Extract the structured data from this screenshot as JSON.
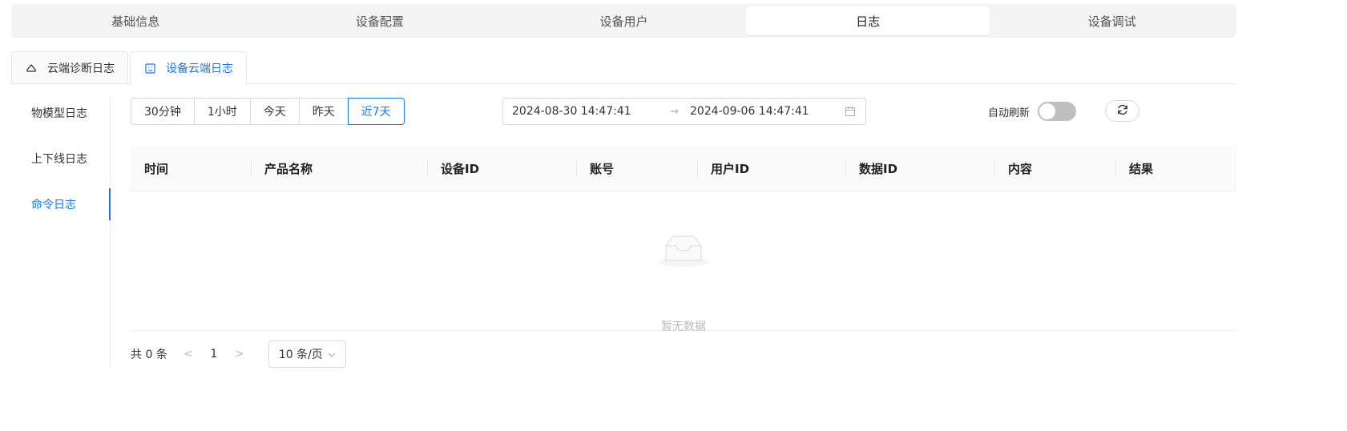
{
  "top_tabs": [
    {
      "label": "基础信息"
    },
    {
      "label": "设备配置"
    },
    {
      "label": "设备用户"
    },
    {
      "label": "日志",
      "active": true
    },
    {
      "label": "设备调试"
    }
  ],
  "card_tabs": [
    {
      "label": "云端诊断日志",
      "icon": "cloud-icon"
    },
    {
      "label": "设备云端日志",
      "icon": "device-icon",
      "active": true
    }
  ],
  "side_menu": [
    {
      "label": "物模型日志"
    },
    {
      "label": "上下线日志"
    },
    {
      "label": "命令日志",
      "active": true
    }
  ],
  "toolbar": {
    "ranges": [
      "30分钟",
      "1小时",
      "今天",
      "昨天",
      "近7天"
    ],
    "active_range": "近7天",
    "date_start": "2024-08-30 14:47:41",
    "date_sep": "→",
    "date_end": "2024-09-06 14:47:41",
    "auto_refresh_label": "自动刷新",
    "auto_refresh_on": false
  },
  "table": {
    "columns": [
      "时间",
      "产品名称",
      "设备ID",
      "账号",
      "用户ID",
      "数据ID",
      "内容",
      "结果"
    ],
    "rows": [],
    "empty_text": "暂无数据"
  },
  "pagination": {
    "total_text": "共 0 条",
    "prev": "<",
    "current_page": "1",
    "next": ">",
    "page_size": "10 条/页"
  },
  "colors": {
    "accent": "#1677ff",
    "border": "#d9d9d9",
    "header_bg": "#fafafa"
  }
}
